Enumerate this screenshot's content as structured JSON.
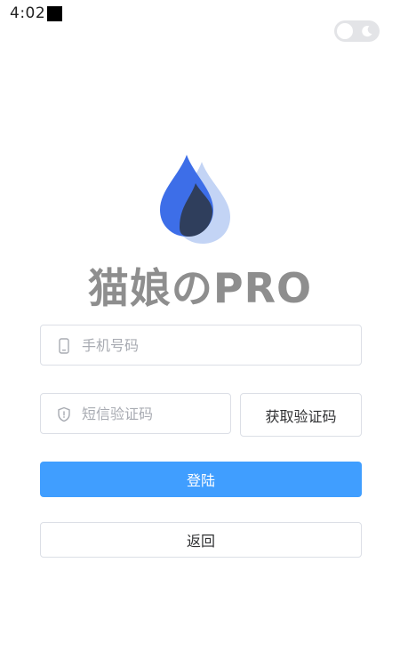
{
  "status_bar": {
    "time": "4:02"
  },
  "theme_toggle": {
    "icon": "moon-icon",
    "state": "light"
  },
  "brand": {
    "title": "猫娘のPRO",
    "logo_icon": "water-drop-logo",
    "logo_colors": [
      "#3d6ee8",
      "#2f3e5c",
      "#c3d4f5"
    ]
  },
  "form": {
    "phone": {
      "icon": "mobile-phone-icon",
      "placeholder": "手机号码",
      "value": ""
    },
    "code": {
      "icon": "shield-icon",
      "placeholder": "短信验证码",
      "value": ""
    },
    "get_code_label": "获取验证码",
    "login_label": "登陆",
    "back_label": "返回"
  },
  "colors": {
    "primary": "#409eff",
    "title": "#8e8e8e",
    "border": "#dcdfe6"
  }
}
